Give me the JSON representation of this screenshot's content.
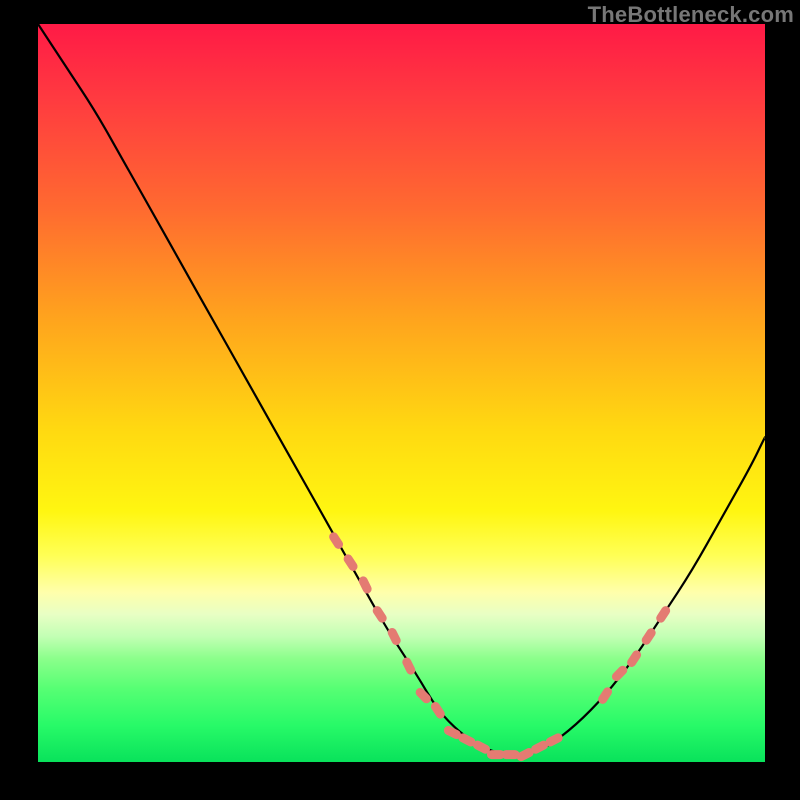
{
  "watermark": "TheBottleneck.com",
  "chart_data": {
    "type": "line",
    "title": "",
    "xlabel": "",
    "ylabel": "",
    "xlim": [
      0,
      100
    ],
    "ylim": [
      0,
      100
    ],
    "x": [
      0,
      4,
      8,
      12,
      16,
      20,
      24,
      28,
      32,
      36,
      40,
      44,
      48,
      52,
      55,
      58,
      61,
      64,
      67,
      70,
      74,
      78,
      82,
      86,
      90,
      94,
      98,
      100
    ],
    "values": [
      100,
      94,
      88,
      81,
      74,
      67,
      60,
      53,
      46,
      39,
      32,
      25,
      18,
      12,
      7,
      4,
      2,
      1,
      1,
      2,
      5,
      9,
      14,
      20,
      26,
      33,
      40,
      44
    ],
    "series": [
      {
        "name": "bottleneck-curve",
        "color": "#000000",
        "x": [
          0,
          4,
          8,
          12,
          16,
          20,
          24,
          28,
          32,
          36,
          40,
          44,
          48,
          52,
          55,
          58,
          61,
          64,
          67,
          70,
          74,
          78,
          82,
          86,
          90,
          94,
          98,
          100
        ],
        "values": [
          100,
          94,
          88,
          81,
          74,
          67,
          60,
          53,
          46,
          39,
          32,
          25,
          18,
          12,
          7,
          4,
          2,
          1,
          1,
          2,
          5,
          9,
          14,
          20,
          26,
          33,
          40,
          44
        ]
      },
      {
        "name": "highlight-dots-left",
        "color": "#e47b72",
        "x": [
          41,
          43,
          45,
          47,
          49,
          51,
          53,
          55,
          57,
          59,
          61,
          63,
          65,
          67,
          69,
          71
        ],
        "values": [
          30,
          27,
          24,
          20,
          17,
          13,
          9,
          7,
          4,
          3,
          2,
          1,
          1,
          1,
          2,
          3
        ]
      },
      {
        "name": "highlight-dots-right",
        "color": "#e47b72",
        "x": [
          78,
          80,
          82,
          84,
          86
        ],
        "values": [
          9,
          12,
          14,
          17,
          20
        ]
      }
    ],
    "colors": {
      "background_top": "#ff1a46",
      "background_bottom": "#09e25b",
      "curve": "#000000",
      "dots": "#e47b72",
      "frame": "#000000"
    }
  }
}
